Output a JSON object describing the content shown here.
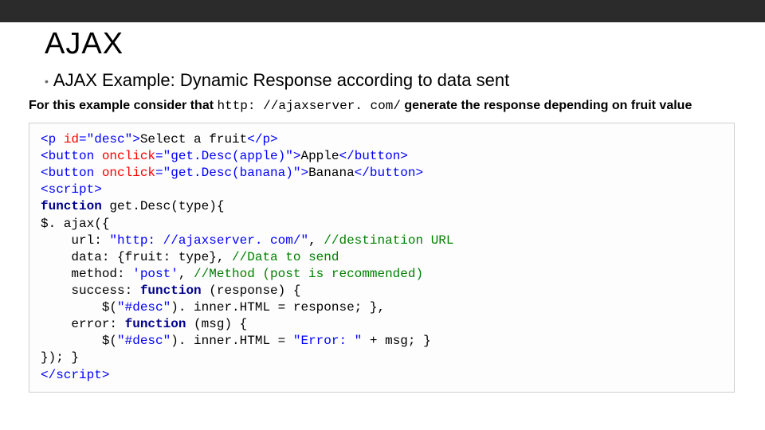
{
  "title": "AJAX",
  "bullet": "AJAX Example: Dynamic Response according to data sent",
  "note_pre": "For this example consider that ",
  "note_url": "http: //ajaxserver. com/",
  "note_post": " generate the response depending on ",
  "note_bold": "fruit",
  "note_end": " value",
  "code": {
    "l1_a": "<p ",
    "l1_b": "id",
    "l1_c": "=\"desc\">",
    "l1_d": "Select a fruit",
    "l1_e": "</p>",
    "l2_a": "<button ",
    "l2_b": "onclick",
    "l2_c": "=\"get.Desc(apple)\">",
    "l2_d": "Apple",
    "l2_e": "</button>",
    "l3_a": "<button ",
    "l3_b": "onclick",
    "l3_c": "=\"get.Desc(banana)\">",
    "l3_d": "Banana",
    "l3_e": "</button>",
    "l4": "<script>",
    "l5_a": "function",
    "l5_b": " get.Desc(type){",
    "l6": "$. ajax({",
    "l7_a": "    url: ",
    "l7_b": "\"http: //ajaxserver. com/\"",
    "l7_c": ", ",
    "l7_d": "//destination URL",
    "l8_a": "    data: {fruit: type}, ",
    "l8_b": "//Data to send",
    "l9_a": "    method: ",
    "l9_b": "'post'",
    "l9_c": ", ",
    "l9_d": "//Method (post is recommended)",
    "l10_a": "    success: ",
    "l10_b": "function",
    "l10_c": " (response) {",
    "l11_a": "        $(",
    "l11_b": "\"#desc\"",
    "l11_c": "). inner.HTML = response; },",
    "l12_a": "    error: ",
    "l12_b": "function",
    "l12_c": " (msg) {",
    "l13_a": "        $(",
    "l13_b": "\"#desc\"",
    "l13_c": "). inner.HTML = ",
    "l13_d": "\"Error: \"",
    "l13_e": " + msg; }",
    "l14": "}); }",
    "l15": "</scr"
  }
}
